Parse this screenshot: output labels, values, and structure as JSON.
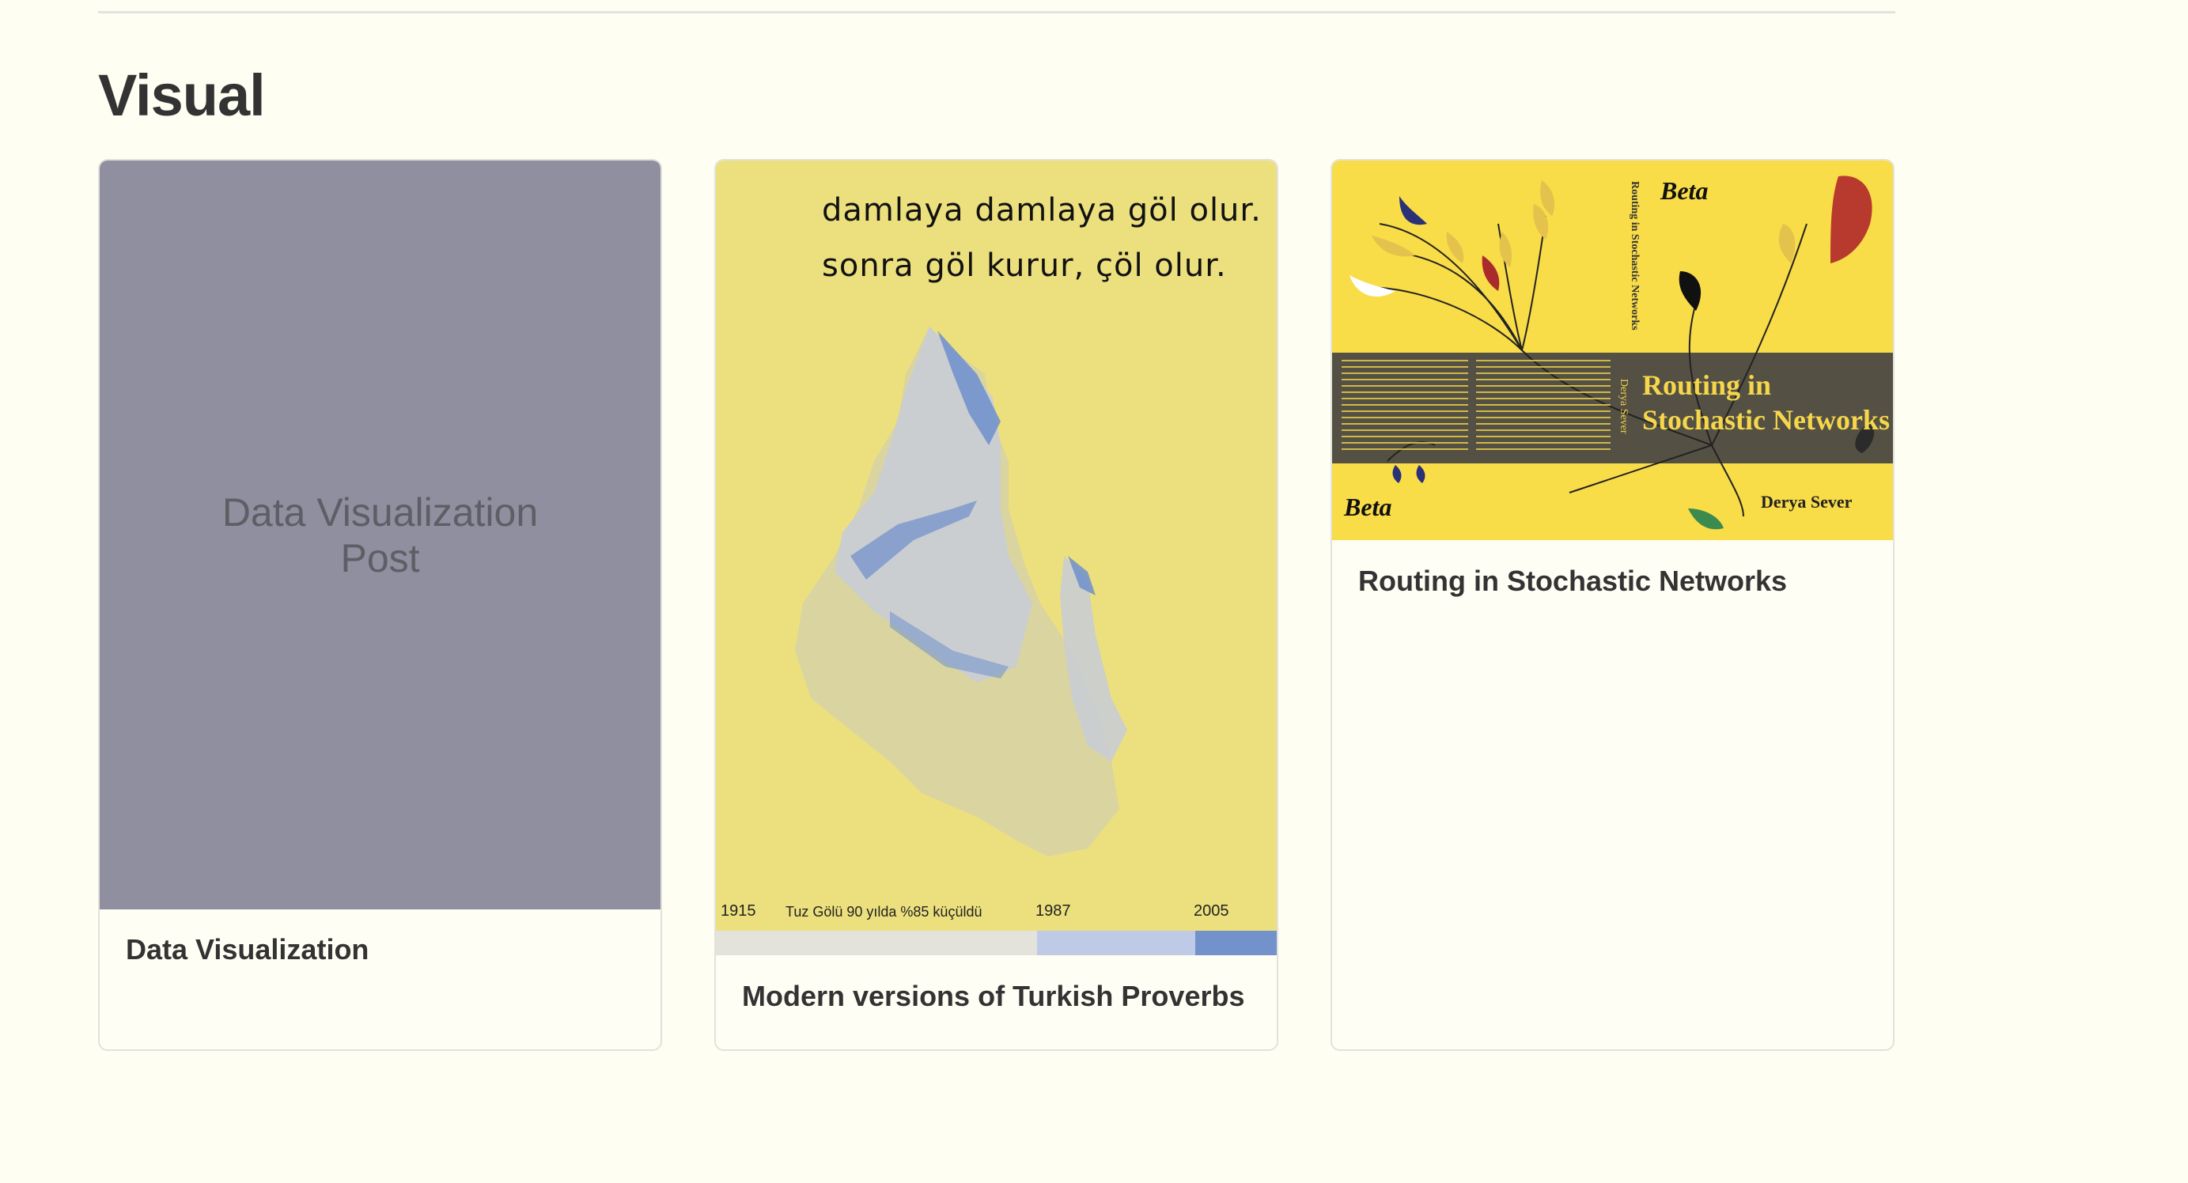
{
  "section": {
    "title": "Visual"
  },
  "cards": [
    {
      "placeholder_text": "Data Visualization\nPost",
      "title": "Data Visualization"
    },
    {
      "title": "Modern versions of Turkish Proverbs",
      "poster": {
        "line1": "damlaya damlaya göl olur.",
        "line2": "sonra göl kurur, çöl olur.",
        "year_start": "1915",
        "caption": "Tuz Gölü 90 yılda %85 küçüldü",
        "year_mid": "1987",
        "year_end": "2005",
        "colors": {
          "background": "#ece07e",
          "lake": "#c9cdd3",
          "water": "#6f8fcc"
        }
      }
    },
    {
      "title": "Routing in Stochastic Networks",
      "cover": {
        "title_line1": "Routing in",
        "title_line2": "Stochastic Networks",
        "author": "Derya Sever",
        "logo": "Beta",
        "spine_title": "Routing in Stochastic Networks",
        "spine_author": "Derya Sever",
        "colors": {
          "background": "#f8dc48",
          "band": "#545144",
          "accent_red": "#b83a2f"
        }
      }
    }
  ],
  "colors": {
    "page_background": "#fffef2",
    "text": "#333333"
  }
}
